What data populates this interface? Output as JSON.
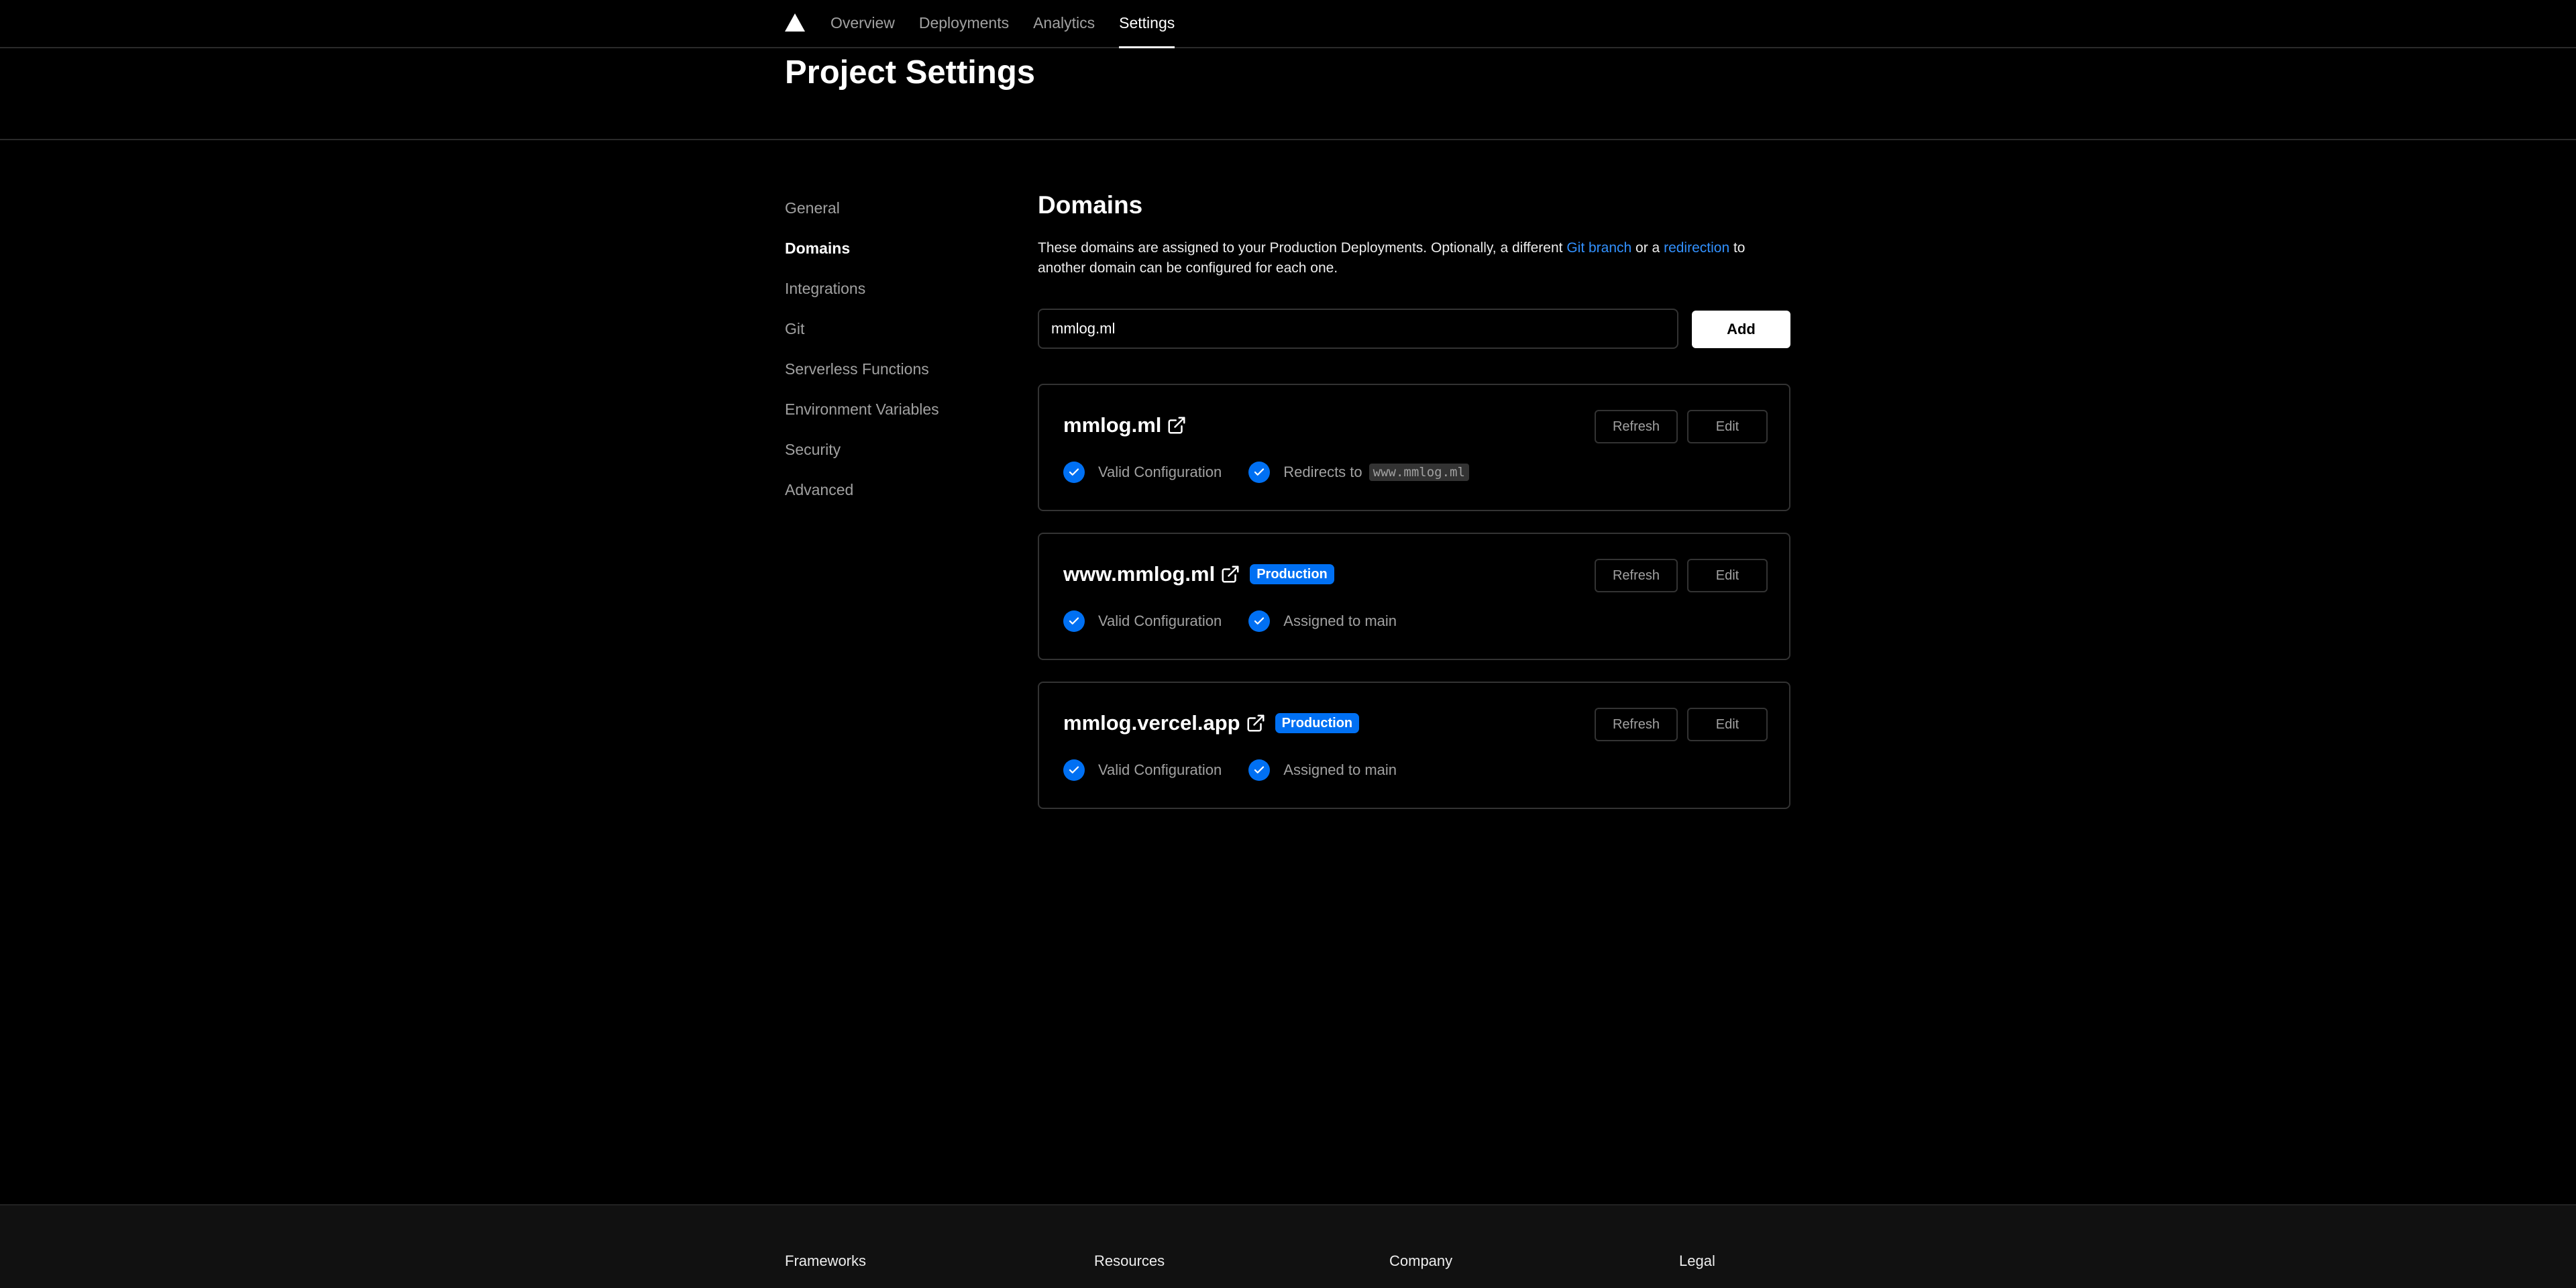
{
  "nav": {
    "tabs": [
      {
        "label": "Overview"
      },
      {
        "label": "Deployments"
      },
      {
        "label": "Analytics"
      },
      {
        "label": "Settings"
      }
    ]
  },
  "header": {
    "title": "Project Settings"
  },
  "sidebar": {
    "items": [
      {
        "label": "General"
      },
      {
        "label": "Domains"
      },
      {
        "label": "Integrations"
      },
      {
        "label": "Git"
      },
      {
        "label": "Serverless Functions"
      },
      {
        "label": "Environment Variables"
      },
      {
        "label": "Security"
      },
      {
        "label": "Advanced"
      }
    ]
  },
  "domains": {
    "title": "Domains",
    "description_pre": "These domains are assigned to your Production Deployments. Optionally, a different ",
    "link_git_branch": "Git branch",
    "description_mid": " or a ",
    "link_redirection": "redirection",
    "description_post": " to another domain can be configured for each one.",
    "input_value": "mmlog.ml",
    "add_label": "Add",
    "refresh_label": "Refresh",
    "edit_label": "Edit",
    "cards": [
      {
        "name": "mmlog.ml",
        "badge": "",
        "status1": "Valid Configuration",
        "status2": "Redirects to",
        "status2_code": "www.mmlog.ml"
      },
      {
        "name": "www.mmlog.ml",
        "badge": "Production",
        "status1": "Valid Configuration",
        "status2": "Assigned to main",
        "status2_code": ""
      },
      {
        "name": "mmlog.vercel.app",
        "badge": "Production",
        "status1": "Valid Configuration",
        "status2": "Assigned to main",
        "status2_code": ""
      }
    ]
  },
  "footer": {
    "columns": [
      {
        "label": "Frameworks"
      },
      {
        "label": "Resources"
      },
      {
        "label": "Company"
      },
      {
        "label": "Legal"
      }
    ]
  },
  "colors": {
    "accent": "#0070f3",
    "link": "#3291ff",
    "background": "#000000"
  }
}
